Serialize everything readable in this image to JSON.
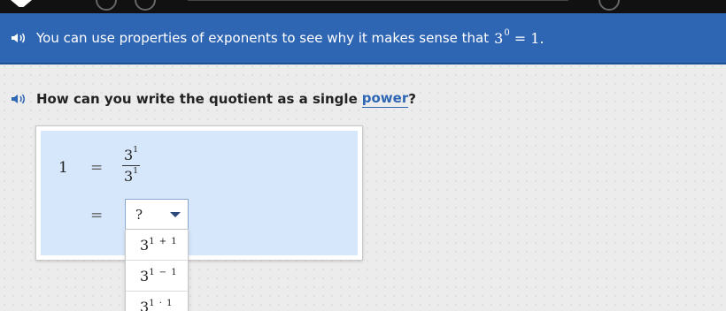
{
  "banner": {
    "text": "You can use properties of exponents to see why it makes sense that",
    "math_base": "3",
    "math_exp": "0",
    "math_rest": "= 1."
  },
  "question": {
    "prefix": "How can you write the quotient as a single",
    "link": "power",
    "suffix": "?"
  },
  "equation": {
    "lhs": "1",
    "equals": "=",
    "numerator_base": "3",
    "numerator_exp": "1",
    "denominator_base": "3",
    "denominator_exp": "1"
  },
  "dropdown": {
    "selected": "?",
    "options": [
      {
        "base": "3",
        "exp": "1 + 1"
      },
      {
        "base": "3",
        "exp": "1 − 1"
      },
      {
        "base": "3",
        "exp": "1 · 1"
      }
    ]
  },
  "colors": {
    "banner": "#2f66b3",
    "panel_fill": "#d6e6fb",
    "link": "#2f66b3"
  },
  "icons": [
    "speaker-icon",
    "chevron-down-icon"
  ]
}
